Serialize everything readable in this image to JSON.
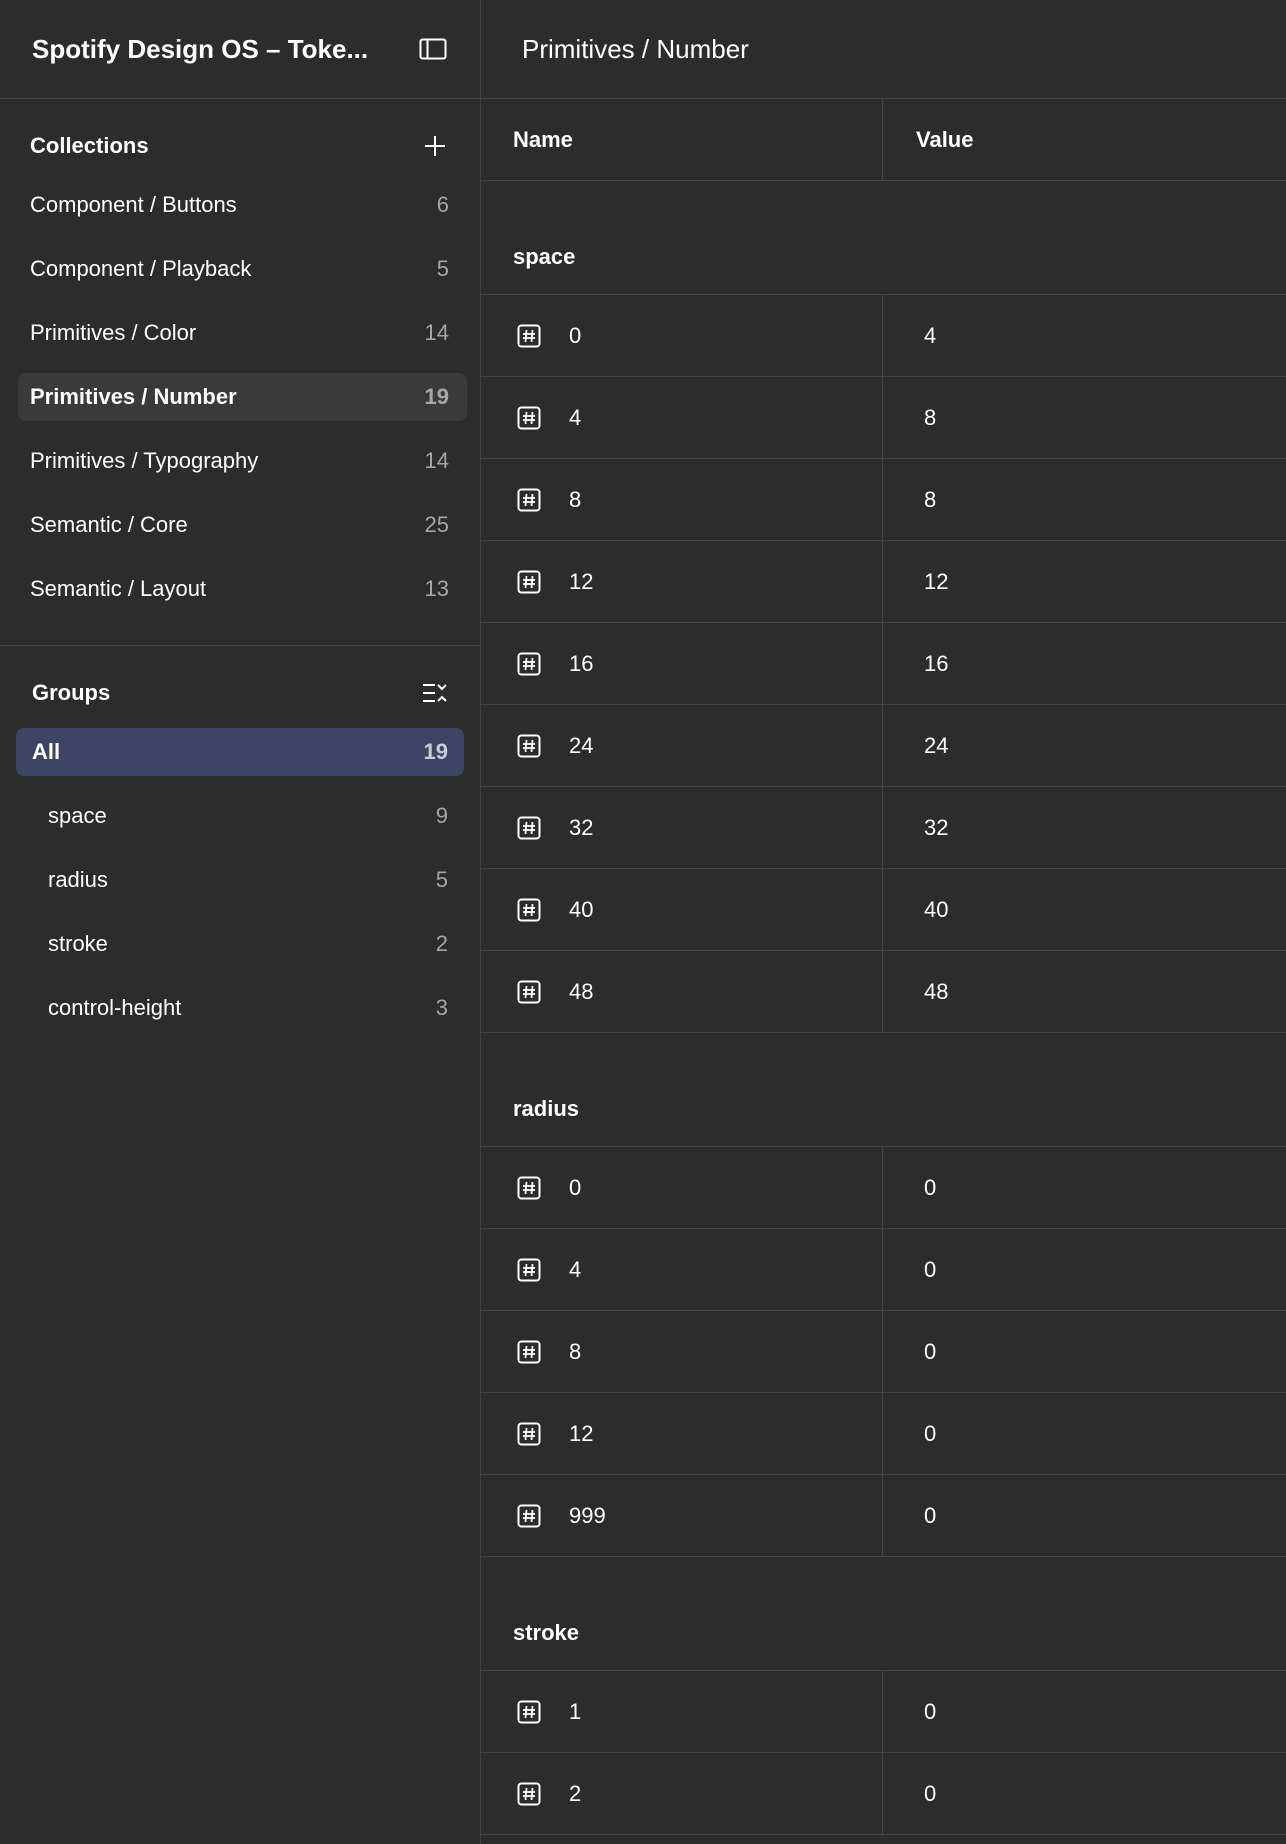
{
  "sidebar": {
    "file_title": "Spotify Design OS – Toke...",
    "collections_title": "Collections",
    "collections": [
      {
        "label": "Component / Buttons",
        "count": "6"
      },
      {
        "label": "Component / Playback",
        "count": "5"
      },
      {
        "label": "Primitives / Color",
        "count": "14"
      },
      {
        "label": "Primitives / Number",
        "count": "19"
      },
      {
        "label": "Primitives / Typography",
        "count": "14"
      },
      {
        "label": "Semantic / Core",
        "count": "25"
      },
      {
        "label": "Semantic / Layout",
        "count": "13"
      }
    ],
    "groups_title": "Groups",
    "groups": [
      {
        "label": "All",
        "count": "19"
      },
      {
        "label": "space",
        "count": "9"
      },
      {
        "label": "radius",
        "count": "5"
      },
      {
        "label": "stroke",
        "count": "2"
      },
      {
        "label": "control-height",
        "count": "3"
      }
    ]
  },
  "main": {
    "title": "Primitives / Number",
    "columns": {
      "name": "Name",
      "value": "Value"
    },
    "groups": [
      {
        "label": "space",
        "rows": [
          {
            "name": "0",
            "value": "4"
          },
          {
            "name": "4",
            "value": "8"
          },
          {
            "name": "8",
            "value": "8"
          },
          {
            "name": "12",
            "value": "12"
          },
          {
            "name": "16",
            "value": "16"
          },
          {
            "name": "24",
            "value": "24"
          },
          {
            "name": "32",
            "value": "32"
          },
          {
            "name": "40",
            "value": "40"
          },
          {
            "name": "48",
            "value": "48"
          }
        ]
      },
      {
        "label": "radius",
        "rows": [
          {
            "name": "0",
            "value": "0"
          },
          {
            "name": "4",
            "value": "0"
          },
          {
            "name": "8",
            "value": "0"
          },
          {
            "name": "12",
            "value": "0"
          },
          {
            "name": "999",
            "value": "0"
          }
        ]
      },
      {
        "label": "stroke",
        "rows": [
          {
            "name": "1",
            "value": "0"
          },
          {
            "name": "2",
            "value": "0"
          }
        ]
      }
    ]
  },
  "icons": {
    "panel_toggle": "sidebar-panel-icon",
    "add": "plus-icon",
    "groups_action": "collapse-list-icon",
    "variable": "number-variable-icon"
  }
}
